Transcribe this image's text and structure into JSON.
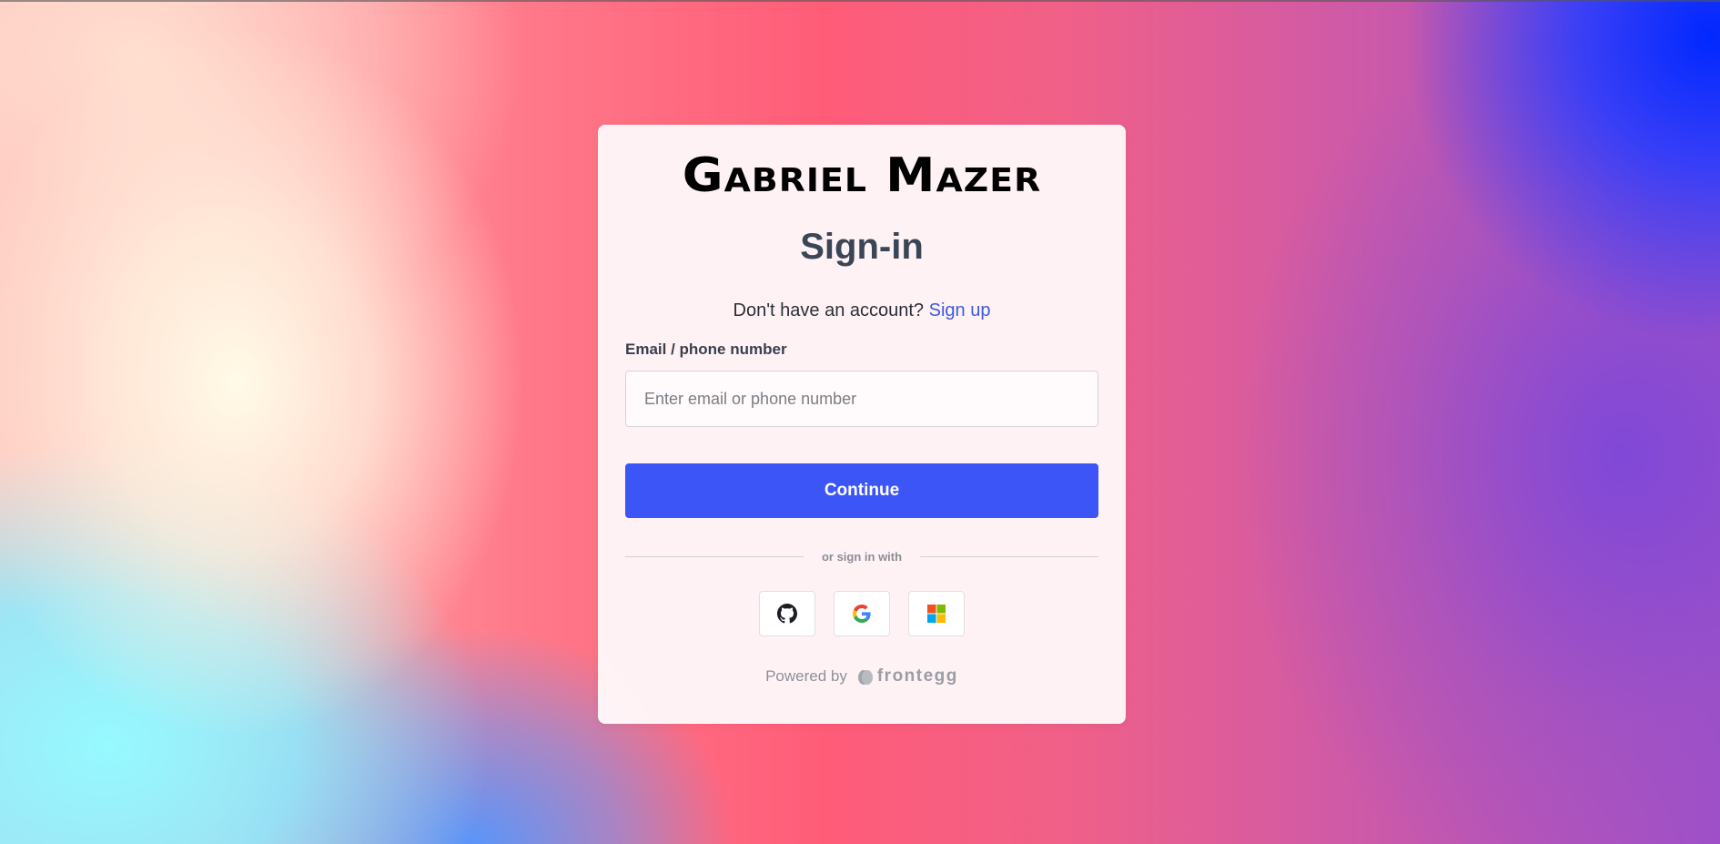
{
  "brand": {
    "logo_text": "Gabriel Mazer"
  },
  "login": {
    "title": "Sign-in",
    "signup_prompt": "Don't have an account?",
    "signup_link": "Sign up",
    "email_label": "Email / phone number",
    "email_placeholder": "Enter email or phone number",
    "email_value": "",
    "continue_label": "Continue",
    "divider_text": "or sign in with",
    "social_providers": [
      {
        "name": "GitHub",
        "icon": "github-icon"
      },
      {
        "name": "Google",
        "icon": "google-icon"
      },
      {
        "name": "Microsoft",
        "icon": "microsoft-icon"
      }
    ]
  },
  "footer": {
    "powered_by": "Powered by",
    "provider_name": "frontegg"
  },
  "colors": {
    "primary_button": "#3b55f6",
    "link": "#3b5bdb",
    "title_text": "#3a4656"
  }
}
